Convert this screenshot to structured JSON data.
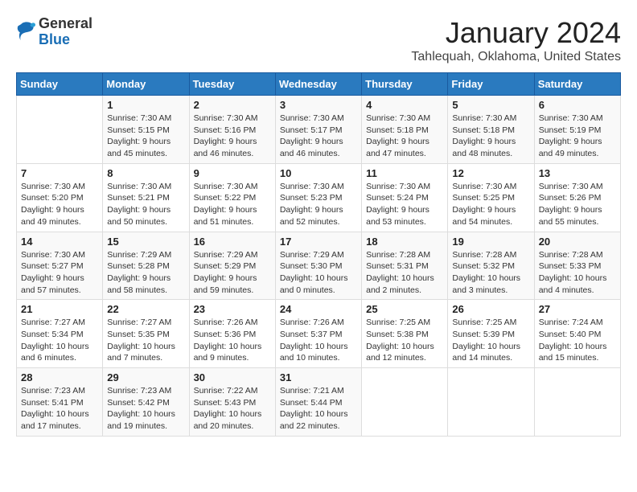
{
  "header": {
    "logo_general": "General",
    "logo_blue": "Blue",
    "month_title": "January 2024",
    "location": "Tahlequah, Oklahoma, United States"
  },
  "calendar": {
    "days_of_week": [
      "Sunday",
      "Monday",
      "Tuesday",
      "Wednesday",
      "Thursday",
      "Friday",
      "Saturday"
    ],
    "weeks": [
      [
        {
          "day": "",
          "info": ""
        },
        {
          "day": "1",
          "info": "Sunrise: 7:30 AM\nSunset: 5:15 PM\nDaylight: 9 hours\nand 45 minutes."
        },
        {
          "day": "2",
          "info": "Sunrise: 7:30 AM\nSunset: 5:16 PM\nDaylight: 9 hours\nand 46 minutes."
        },
        {
          "day": "3",
          "info": "Sunrise: 7:30 AM\nSunset: 5:17 PM\nDaylight: 9 hours\nand 46 minutes."
        },
        {
          "day": "4",
          "info": "Sunrise: 7:30 AM\nSunset: 5:18 PM\nDaylight: 9 hours\nand 47 minutes."
        },
        {
          "day": "5",
          "info": "Sunrise: 7:30 AM\nSunset: 5:18 PM\nDaylight: 9 hours\nand 48 minutes."
        },
        {
          "day": "6",
          "info": "Sunrise: 7:30 AM\nSunset: 5:19 PM\nDaylight: 9 hours\nand 49 minutes."
        }
      ],
      [
        {
          "day": "7",
          "info": "Sunrise: 7:30 AM\nSunset: 5:20 PM\nDaylight: 9 hours\nand 49 minutes."
        },
        {
          "day": "8",
          "info": "Sunrise: 7:30 AM\nSunset: 5:21 PM\nDaylight: 9 hours\nand 50 minutes."
        },
        {
          "day": "9",
          "info": "Sunrise: 7:30 AM\nSunset: 5:22 PM\nDaylight: 9 hours\nand 51 minutes."
        },
        {
          "day": "10",
          "info": "Sunrise: 7:30 AM\nSunset: 5:23 PM\nDaylight: 9 hours\nand 52 minutes."
        },
        {
          "day": "11",
          "info": "Sunrise: 7:30 AM\nSunset: 5:24 PM\nDaylight: 9 hours\nand 53 minutes."
        },
        {
          "day": "12",
          "info": "Sunrise: 7:30 AM\nSunset: 5:25 PM\nDaylight: 9 hours\nand 54 minutes."
        },
        {
          "day": "13",
          "info": "Sunrise: 7:30 AM\nSunset: 5:26 PM\nDaylight: 9 hours\nand 55 minutes."
        }
      ],
      [
        {
          "day": "14",
          "info": "Sunrise: 7:30 AM\nSunset: 5:27 PM\nDaylight: 9 hours\nand 57 minutes."
        },
        {
          "day": "15",
          "info": "Sunrise: 7:29 AM\nSunset: 5:28 PM\nDaylight: 9 hours\nand 58 minutes."
        },
        {
          "day": "16",
          "info": "Sunrise: 7:29 AM\nSunset: 5:29 PM\nDaylight: 9 hours\nand 59 minutes."
        },
        {
          "day": "17",
          "info": "Sunrise: 7:29 AM\nSunset: 5:30 PM\nDaylight: 10 hours\nand 0 minutes."
        },
        {
          "day": "18",
          "info": "Sunrise: 7:28 AM\nSunset: 5:31 PM\nDaylight: 10 hours\nand 2 minutes."
        },
        {
          "day": "19",
          "info": "Sunrise: 7:28 AM\nSunset: 5:32 PM\nDaylight: 10 hours\nand 3 minutes."
        },
        {
          "day": "20",
          "info": "Sunrise: 7:28 AM\nSunset: 5:33 PM\nDaylight: 10 hours\nand 4 minutes."
        }
      ],
      [
        {
          "day": "21",
          "info": "Sunrise: 7:27 AM\nSunset: 5:34 PM\nDaylight: 10 hours\nand 6 minutes."
        },
        {
          "day": "22",
          "info": "Sunrise: 7:27 AM\nSunset: 5:35 PM\nDaylight: 10 hours\nand 7 minutes."
        },
        {
          "day": "23",
          "info": "Sunrise: 7:26 AM\nSunset: 5:36 PM\nDaylight: 10 hours\nand 9 minutes."
        },
        {
          "day": "24",
          "info": "Sunrise: 7:26 AM\nSunset: 5:37 PM\nDaylight: 10 hours\nand 10 minutes."
        },
        {
          "day": "25",
          "info": "Sunrise: 7:25 AM\nSunset: 5:38 PM\nDaylight: 10 hours\nand 12 minutes."
        },
        {
          "day": "26",
          "info": "Sunrise: 7:25 AM\nSunset: 5:39 PM\nDaylight: 10 hours\nand 14 minutes."
        },
        {
          "day": "27",
          "info": "Sunrise: 7:24 AM\nSunset: 5:40 PM\nDaylight: 10 hours\nand 15 minutes."
        }
      ],
      [
        {
          "day": "28",
          "info": "Sunrise: 7:23 AM\nSunset: 5:41 PM\nDaylight: 10 hours\nand 17 minutes."
        },
        {
          "day": "29",
          "info": "Sunrise: 7:23 AM\nSunset: 5:42 PM\nDaylight: 10 hours\nand 19 minutes."
        },
        {
          "day": "30",
          "info": "Sunrise: 7:22 AM\nSunset: 5:43 PM\nDaylight: 10 hours\nand 20 minutes."
        },
        {
          "day": "31",
          "info": "Sunrise: 7:21 AM\nSunset: 5:44 PM\nDaylight: 10 hours\nand 22 minutes."
        },
        {
          "day": "",
          "info": ""
        },
        {
          "day": "",
          "info": ""
        },
        {
          "day": "",
          "info": ""
        }
      ]
    ]
  }
}
